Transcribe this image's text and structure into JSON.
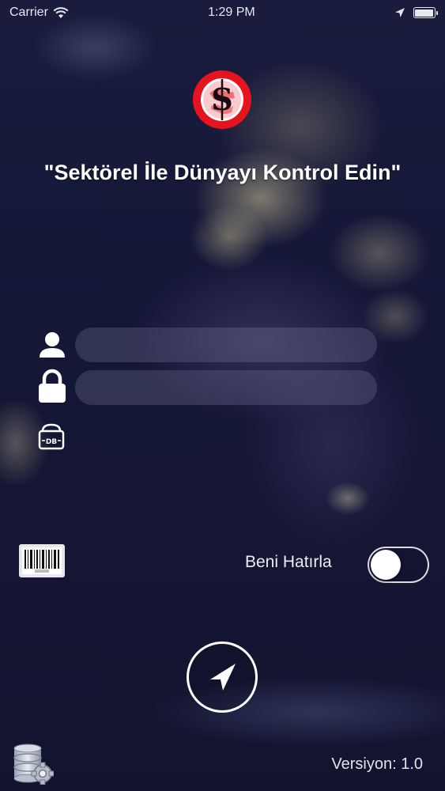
{
  "status_bar": {
    "carrier": "Carrier",
    "time": "1:29 PM"
  },
  "header": {
    "slogan": "\"Sektörel İle Dünyayı Kontrol Edin\""
  },
  "login": {
    "username": {
      "value": "",
      "placeholder": ""
    },
    "password": {
      "value": "",
      "placeholder": ""
    }
  },
  "remember": {
    "label": "Beni Hatırla",
    "on": false
  },
  "footer": {
    "version": "Versiyon: 1.0"
  },
  "colors": {
    "logo_red": "#e6141e",
    "background": "#151737",
    "text": "#ffffff"
  },
  "icons": {
    "user": "user-icon",
    "lock": "lock-icon",
    "database": "database-icon",
    "barcode": "barcode-icon",
    "navigation": "navigation-arrow-icon",
    "settings": "database-settings-icon"
  }
}
